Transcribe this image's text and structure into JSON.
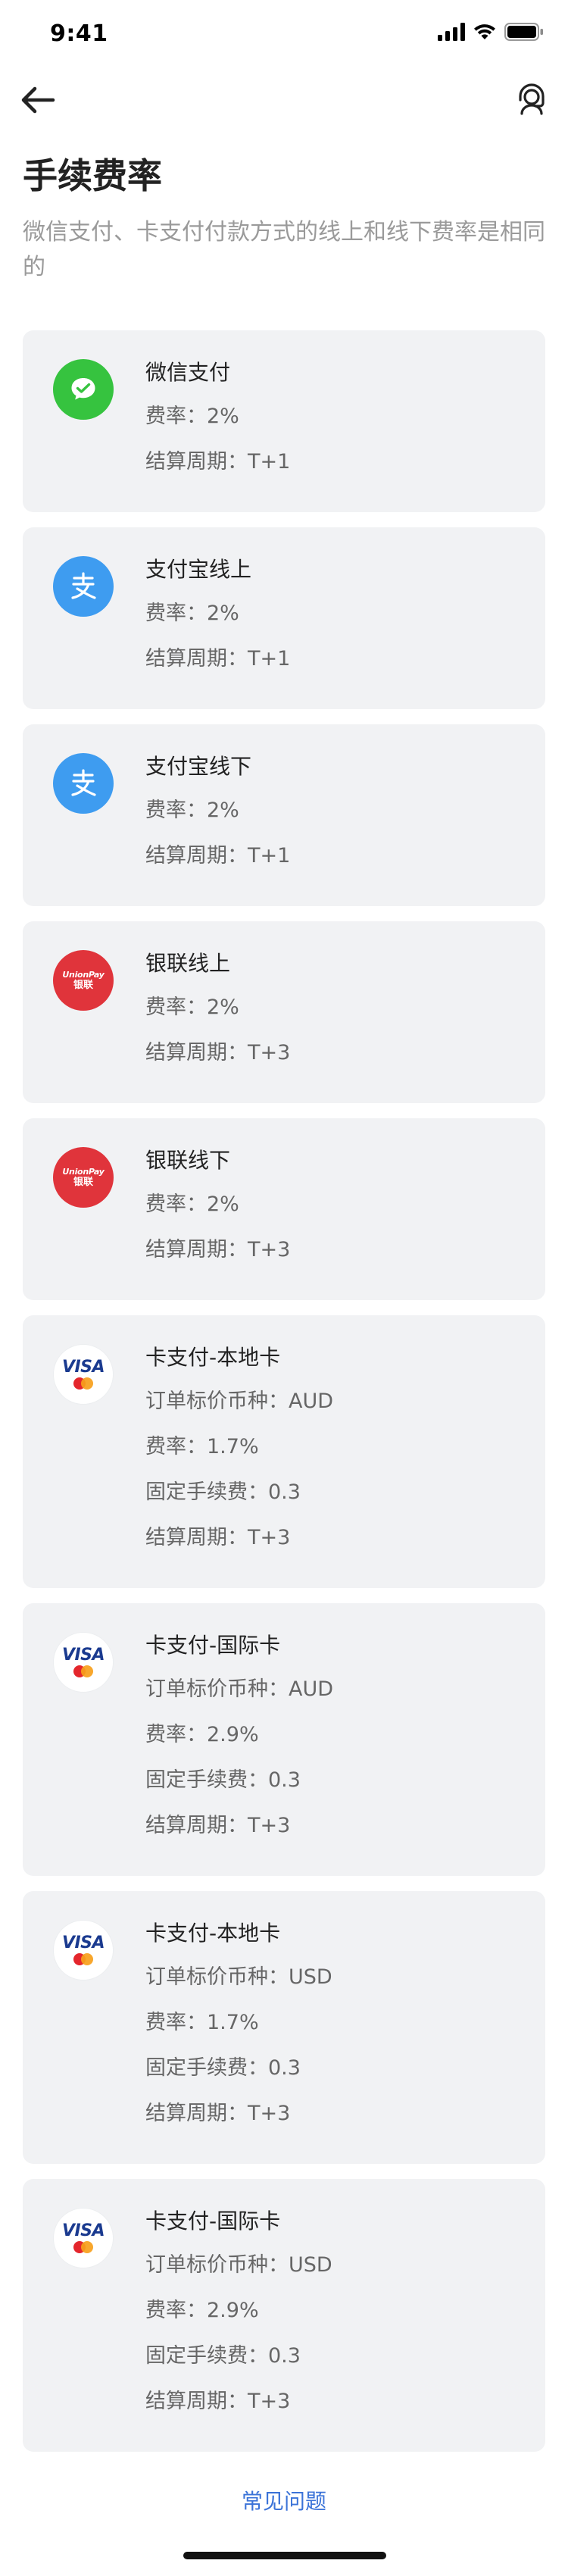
{
  "status_bar": {
    "time": "9:41"
  },
  "header": {
    "title": "手续费率",
    "subtitle": "微信支付、卡支付付款方式的线上和线下费率是相同的"
  },
  "labels": {
    "rate": "费率：",
    "settlement": "结算周期：",
    "currency": "订单标价币种：",
    "fixed_fee": "固定手续费："
  },
  "logos": {
    "unionpay_top": "UnionPay",
    "unionpay_bottom": "银联",
    "visa": "VISA"
  },
  "cards": [
    {
      "name": "微信支付",
      "logo": "wechat-pay-icon",
      "rate": "2%",
      "settlement": "T+1"
    },
    {
      "name": "支付宝线上",
      "logo": "alipay-icon",
      "rate": "2%",
      "settlement": "T+1"
    },
    {
      "name": "支付宝线下",
      "logo": "alipay-icon",
      "rate": "2%",
      "settlement": "T+1"
    },
    {
      "name": "银联线上",
      "logo": "unionpay-icon",
      "rate": "2%",
      "settlement": "T+3"
    },
    {
      "name": "银联线下",
      "logo": "unionpay-icon",
      "rate": "2%",
      "settlement": "T+3"
    },
    {
      "name": "卡支付-本地卡",
      "logo": "visa-mastercard-icon",
      "currency": "AUD",
      "rate": "1.7%",
      "fixed_fee": "0.3",
      "settlement": "T+3"
    },
    {
      "name": "卡支付-国际卡",
      "logo": "visa-mastercard-icon",
      "currency": "AUD",
      "rate": "2.9%",
      "fixed_fee": "0.3",
      "settlement": "T+3"
    },
    {
      "name": "卡支付-本地卡",
      "logo": "visa-mastercard-icon",
      "currency": "USD",
      "rate": "1.7%",
      "fixed_fee": "0.3",
      "settlement": "T+3"
    },
    {
      "name": "卡支付-国际卡",
      "logo": "visa-mastercard-icon",
      "currency": "USD",
      "rate": "2.9%",
      "fixed_fee": "0.3",
      "settlement": "T+3"
    }
  ],
  "footer": {
    "faq_label": "常见问题"
  },
  "colors": {
    "wechat": "#36c33f",
    "alipay": "#3e9cf0",
    "unionpay": "#e0343b",
    "link": "#3b73d8",
    "card_bg": "#f1f2f4"
  }
}
